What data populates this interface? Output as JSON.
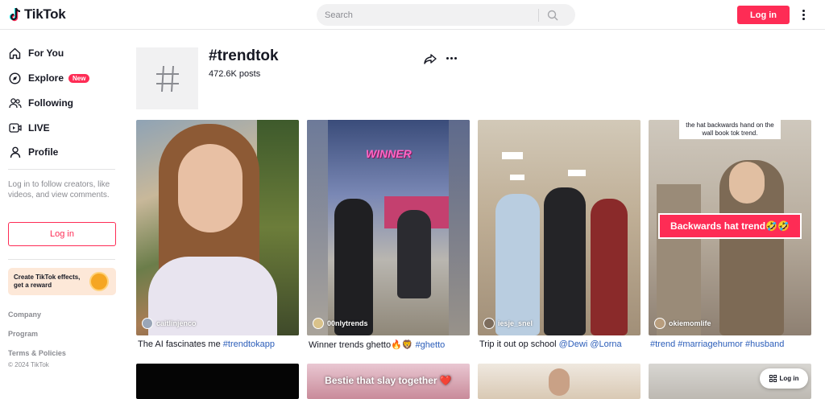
{
  "header": {
    "logo_text": "TikTok",
    "search_placeholder": "Search",
    "login_label": "Log in"
  },
  "sidebar": {
    "nav": [
      {
        "label": "For You",
        "icon": "home-icon"
      },
      {
        "label": "Explore",
        "icon": "compass-icon",
        "badge": "New"
      },
      {
        "label": "Following",
        "icon": "users-icon"
      },
      {
        "label": "LIVE",
        "icon": "live-icon"
      },
      {
        "label": "Profile",
        "icon": "person-icon"
      }
    ],
    "login_prompt": "Log in to follow creators, like videos, and view comments.",
    "login_label": "Log in",
    "effects_text": "Create TikTok effects, get a reward",
    "footer_links": [
      "Company",
      "Program",
      "Terms & Policies"
    ],
    "copyright": "© 2024 TikTok"
  },
  "hashtag": {
    "title": "#trendtok",
    "posts": "472.6K posts"
  },
  "videos": [
    {
      "username": "caitlinjenco",
      "caption_text": "The AI fascinates me ",
      "caption_tags": "#trendtokapp"
    },
    {
      "username": "00nlytrends",
      "caption_text": "Winner trends ghetto🔥🦁 ",
      "caption_tags": "#ghetto",
      "overlay": "WINNER"
    },
    {
      "username": "iesje_snel",
      "caption_text": "Trip it out op school ",
      "caption_tags": "@Dewi @Lorna"
    },
    {
      "username": "okiemomlife",
      "caption_text": "",
      "caption_tags": "#trend #marriagehumor #husband",
      "top_text": "the hat backwards hand on the wall book tok trend.",
      "overlay": "Backwards hat trend🤣🤣"
    }
  ],
  "bottom_row": {
    "card2_text": "Bestie that slay together ❤️"
  },
  "floating_login": "Log in",
  "colors": {
    "accent": "#fe2c55",
    "link": "#2b5db9"
  }
}
